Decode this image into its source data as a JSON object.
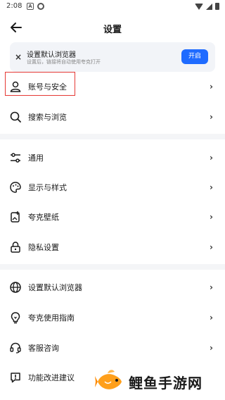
{
  "status": {
    "time": "2:08",
    "icon_a": "A"
  },
  "header": {
    "title": "设置"
  },
  "banner": {
    "close": "×",
    "title": "设置默认浏览器",
    "subtitle": "设置后，链接将自动使用夸克打开",
    "button": "开启"
  },
  "menu": [
    {
      "label": "账号与安全",
      "icon": "user-icon"
    },
    {
      "label": "搜索与浏览",
      "icon": "search-icon"
    },
    {
      "label": "通用",
      "icon": "sliders-icon"
    },
    {
      "label": "显示与样式",
      "icon": "palette-icon"
    },
    {
      "label": "夸克壁纸",
      "icon": "wallpaper-icon"
    },
    {
      "label": "隐私设置",
      "icon": "lock-icon"
    },
    {
      "label": "设置默认浏览器",
      "icon": "globe-icon"
    },
    {
      "label": "夸克使用指南",
      "icon": "bulb-icon"
    },
    {
      "label": "客服咨询",
      "icon": "headset-icon"
    },
    {
      "label": "功能改进建议",
      "icon": "feedback-icon"
    }
  ],
  "chevron": "›",
  "watermark": {
    "text": "鲤鱼手游网",
    "icon": "fish-icon"
  },
  "colors": {
    "accent": "#1f6bff",
    "highlight": "#e53935",
    "divider": "#f4f5f7"
  }
}
